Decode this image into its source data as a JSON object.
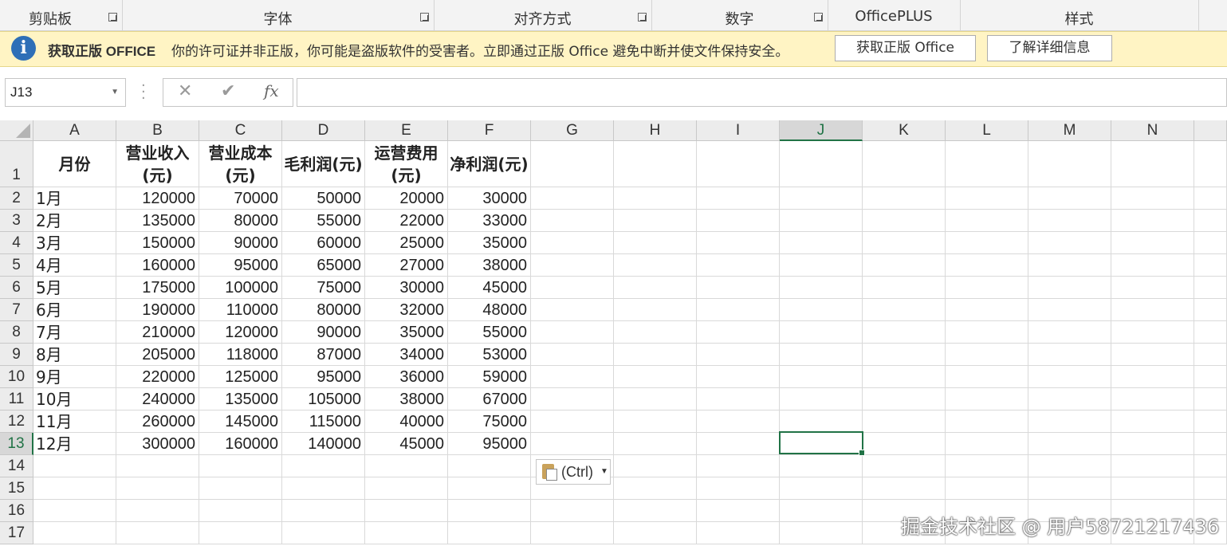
{
  "ribbon": {
    "groups": [
      {
        "label": "剪贴板",
        "launcher": true
      },
      {
        "label": "字体",
        "launcher": true
      },
      {
        "label": "对齐方式",
        "launcher": true
      },
      {
        "label": "数字",
        "launcher": true
      },
      {
        "label": "OfficePLUS",
        "launcher": false
      },
      {
        "label": "样式",
        "launcher": false
      }
    ]
  },
  "message_bar": {
    "icon": "info-icon",
    "title": "获取正版 OFFICE",
    "text": "你的许可证并非正版，你可能是盗版软件的受害者。立即通过正版 Office 避免中断并使文件保持安全。",
    "button_get": "获取正版 Office",
    "button_learn": "了解详细信息",
    "bg_color": "#fff4c4"
  },
  "formula_bar": {
    "name_box": "J13",
    "cancel_icon": "✕",
    "enter_icon": "✔",
    "fx_label": "fx",
    "formula": ""
  },
  "grid": {
    "columns": [
      "A",
      "B",
      "C",
      "D",
      "E",
      "F",
      "G",
      "H",
      "I",
      "J",
      "K",
      "L",
      "M",
      "N"
    ],
    "selected_column": "J",
    "rows": [
      "1",
      "2",
      "3",
      "4",
      "5",
      "6",
      "7",
      "8",
      "9",
      "10",
      "11",
      "12",
      "13",
      "14",
      "15",
      "16",
      "17"
    ],
    "selected_row": "13",
    "header_row": [
      "月份",
      "营业收入(元)",
      "营业成本(元)",
      "毛利润(元)",
      "运营费用(元)",
      "净利润(元)"
    ],
    "data": [
      [
        "1月",
        "120000",
        "70000",
        "50000",
        "20000",
        "30000"
      ],
      [
        "2月",
        "135000",
        "80000",
        "55000",
        "22000",
        "33000"
      ],
      [
        "3月",
        "150000",
        "90000",
        "60000",
        "25000",
        "35000"
      ],
      [
        "4月",
        "160000",
        "95000",
        "65000",
        "27000",
        "38000"
      ],
      [
        "5月",
        "175000",
        "100000",
        "75000",
        "30000",
        "45000"
      ],
      [
        "6月",
        "190000",
        "110000",
        "80000",
        "32000",
        "48000"
      ],
      [
        "7月",
        "210000",
        "120000",
        "90000",
        "35000",
        "55000"
      ],
      [
        "8月",
        "205000",
        "118000",
        "87000",
        "34000",
        "53000"
      ],
      [
        "9月",
        "220000",
        "125000",
        "95000",
        "36000",
        "59000"
      ],
      [
        "10月",
        "240000",
        "135000",
        "105000",
        "38000",
        "67000"
      ],
      [
        "11月",
        "260000",
        "145000",
        "115000",
        "40000",
        "75000"
      ],
      [
        "12月",
        "300000",
        "160000",
        "140000",
        "45000",
        "95000"
      ]
    ],
    "accent_color": "#217346"
  },
  "paste_options": {
    "label": "(Ctrl)",
    "icon": "clipboard-icon"
  },
  "watermark": "掘金技术社区 @ 用户58721217436"
}
